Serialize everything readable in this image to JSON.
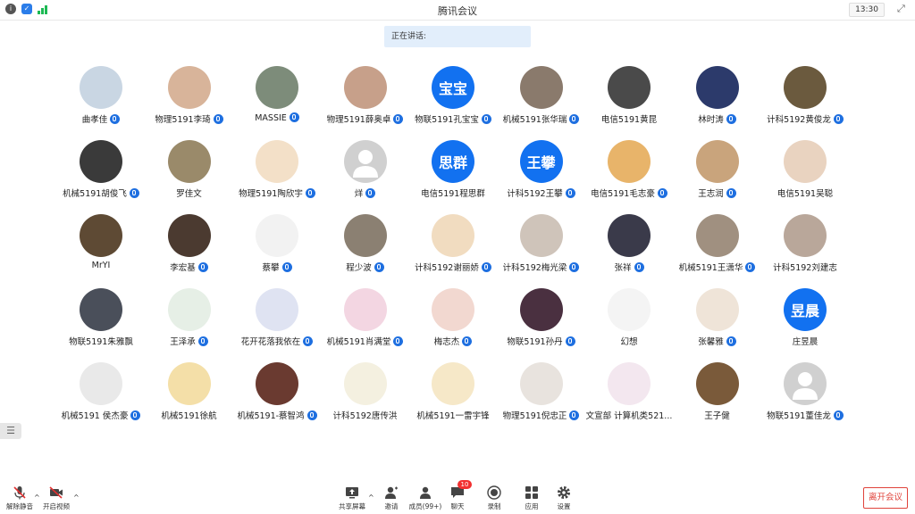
{
  "window": {
    "title": "腾讯会议",
    "clock": "13:30"
  },
  "speaking": {
    "label": "正在讲话:"
  },
  "participants": [
    {
      "name": "曲孝佳",
      "mic": true,
      "color": "#c9d6e3"
    },
    {
      "name": "物理5191李琦",
      "mic": true,
      "color": "#d8b49a"
    },
    {
      "name": "MASSIE",
      "mic": true,
      "color": "#7d8c7a"
    },
    {
      "name": "物理5191薛奥卓",
      "mic": true,
      "color": "#c7a08a"
    },
    {
      "name": "物联5191孔宝宝",
      "mic": true,
      "text": "宝宝"
    },
    {
      "name": "机械5191张华瑞",
      "mic": true,
      "color": "#8a7a6c"
    },
    {
      "name": "电信5191黄昆",
      "mic": false,
      "color": "#4a4a4a"
    },
    {
      "name": "林时涛",
      "mic": true,
      "color": "#2c3a6b"
    },
    {
      "name": "计科5192黄俊龙",
      "mic": true,
      "color": "#6b5a3e"
    },
    {
      "name": "机械5191胡俊飞",
      "mic": true,
      "color": "#3a3a3a"
    },
    {
      "name": "罗佳文",
      "mic": false,
      "color": "#9a8a6a"
    },
    {
      "name": "物理5191陶欣宇",
      "mic": true,
      "color": "#f3e0c8"
    },
    {
      "name": "烊",
      "mic": true,
      "color": "#d0d0d0"
    },
    {
      "name": "电信5191程思群",
      "mic": false,
      "text": "思群"
    },
    {
      "name": "计科5192王攀",
      "mic": true,
      "text": "王攀"
    },
    {
      "name": "电信5191毛志豪",
      "mic": true,
      "color": "#e8b46a"
    },
    {
      "name": "王志润",
      "mic": true,
      "color": "#c9a47c"
    },
    {
      "name": "电信5191吴聪",
      "mic": false,
      "color": "#e9d3c0"
    },
    {
      "name": "MrYI",
      "mic": false,
      "color": "#5e4a34"
    },
    {
      "name": "李宏基",
      "mic": true,
      "color": "#4b3a30"
    },
    {
      "name": "蔡攀",
      "mic": true,
      "color": "#f2f2f2"
    },
    {
      "name": "程少波",
      "mic": true,
      "color": "#8b8072"
    },
    {
      "name": "计科5192谢丽娇",
      "mic": true,
      "color": "#f1dcc0"
    },
    {
      "name": "计科5192梅光梁",
      "mic": true,
      "color": "#cfc4ba"
    },
    {
      "name": "张祥",
      "mic": true,
      "color": "#3a3a4a"
    },
    {
      "name": "机械5191王潇华",
      "mic": true,
      "color": "#a09080"
    },
    {
      "name": "计科5192刘建志",
      "mic": false,
      "color": "#b9a79a"
    },
    {
      "name": "物联5191朱雅飘",
      "mic": false,
      "color": "#4a4f5a"
    },
    {
      "name": "王泽承",
      "mic": true,
      "color": "#e6efe6"
    },
    {
      "name": "花开花落我依在",
      "mic": true,
      "color": "#dfe3f2"
    },
    {
      "name": "机械5191肖满堂",
      "mic": true,
      "color": "#f3d6e2"
    },
    {
      "name": "梅志杰",
      "mic": true,
      "color": "#f2d8d0"
    },
    {
      "name": "物联5191孙丹",
      "mic": true,
      "color": "#4a3040"
    },
    {
      "name": "幻想",
      "mic": false,
      "color": "#f4f4f4"
    },
    {
      "name": "张馨雅",
      "mic": true,
      "color": "#efe4d8"
    },
    {
      "name": "庄昱晨",
      "mic": false,
      "text": "昱晨"
    },
    {
      "name": "机械5191 侯杰豪",
      "mic": true,
      "color": "#e9e9e9"
    },
    {
      "name": "机械5191徐航",
      "mic": false,
      "color": "#f4dfa8"
    },
    {
      "name": "机械5191-蔡智鸿",
      "mic": true,
      "color": "#6a3a30"
    },
    {
      "name": "计科5192唐传洪",
      "mic": false,
      "color": "#f4f0e0"
    },
    {
      "name": "机械5191一雷宇锋",
      "mic": false,
      "color": "#f6e8c8"
    },
    {
      "name": "物理5191倪忠正",
      "mic": true,
      "color": "#e8e3de"
    },
    {
      "name": "文宣部 计算机类521...",
      "mic": false,
      "color": "#f3e7ef"
    },
    {
      "name": "王子健",
      "mic": false,
      "color": "#7a5a3a"
    },
    {
      "name": "物联5191董佳龙",
      "mic": true,
      "color": "#d0d0d0"
    }
  ],
  "toolbar": {
    "unmute": "解除静音",
    "start_video": "开启视频",
    "share_screen": "共享屏幕",
    "invite": "邀请",
    "members": "成员(99+)",
    "chat": "聊天",
    "chat_badge": "10",
    "record": "录制",
    "apps": "应用",
    "settings": "设置",
    "leave": "离开会议"
  }
}
